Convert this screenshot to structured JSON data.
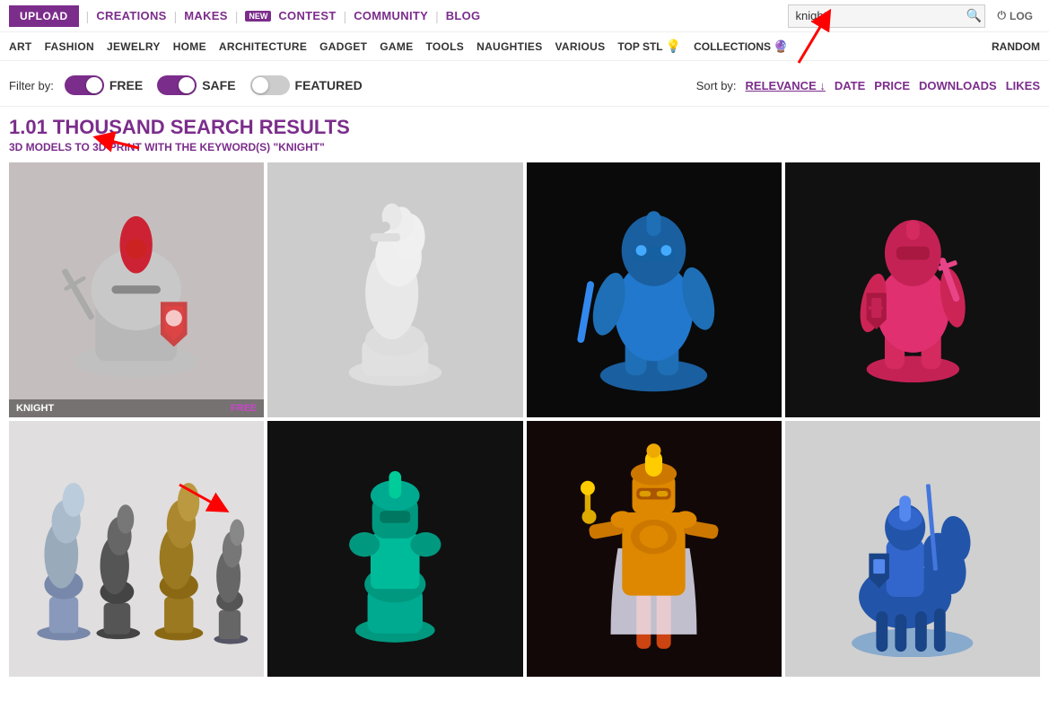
{
  "nav": {
    "upload_label": "UPLOAD",
    "creations_label": "CREATIONS",
    "makes_label": "MAKES",
    "new_badge": "NEW",
    "contest_label": "CONTEST",
    "community_label": "COMMUNITY",
    "blog_label": "BLOG",
    "log_label": "LOG",
    "search_placeholder": "knight",
    "search_value": "knight"
  },
  "second_nav": {
    "items": [
      {
        "label": "ART"
      },
      {
        "label": "FASHION"
      },
      {
        "label": "JEWELRY"
      },
      {
        "label": "HOME"
      },
      {
        "label": "ARCHITECTURE"
      },
      {
        "label": "GADGET"
      },
      {
        "label": "GAME"
      },
      {
        "label": "TOOLS"
      },
      {
        "label": "NAUGHTIES"
      },
      {
        "label": "VARIOUS"
      },
      {
        "label": "TOP STL"
      },
      {
        "label": "COLLECTIONS"
      },
      {
        "label": "RANDOM"
      }
    ]
  },
  "filters": {
    "filter_by_label": "Filter by:",
    "free_label": "FREE",
    "safe_label": "SAFE",
    "featured_label": "FEATURED",
    "free_on": true,
    "safe_on": true,
    "featured_on": false,
    "sort_by_label": "Sort by:",
    "sort_options": [
      {
        "label": "RELEVANCE ↓",
        "active": true
      },
      {
        "label": "DATE",
        "active": false
      },
      {
        "label": "PRICE",
        "active": false
      },
      {
        "label": "DOWNLOADS",
        "active": false
      },
      {
        "label": "LIKES",
        "active": false
      }
    ]
  },
  "results": {
    "count": "1.01 THOUSAND SEARCH RESULTS",
    "subtitle": "3D MODELS TO 3D PRINT WITH THE KEYWORD(S) \"KNIGHT\""
  },
  "grid_items": [
    {
      "name": "KNIGHT",
      "tag": "FREE",
      "bg": "#c8c0c0",
      "description": "knight helmet figurine"
    },
    {
      "name": "",
      "tag": "",
      "bg": "#b8b8b8",
      "description": "white chess knight piece"
    },
    {
      "name": "",
      "tag": "",
      "bg": "#111111",
      "description": "blue knight figurine"
    },
    {
      "name": "",
      "tag": "",
      "bg": "#0a0a0a",
      "description": "pink knight figurine"
    },
    {
      "name": "",
      "tag": "",
      "bg": "#e8e8e8",
      "description": "chess knight set multiple pieces"
    },
    {
      "name": "",
      "tag": "",
      "bg": "#111111",
      "description": "teal knight chess figurine"
    },
    {
      "name": "",
      "tag": "",
      "bg": "#1a1010",
      "description": "gold red knight figurine"
    },
    {
      "name": "",
      "tag": "",
      "bg": "#d0d0d0",
      "description": "blue knight on horse"
    }
  ]
}
